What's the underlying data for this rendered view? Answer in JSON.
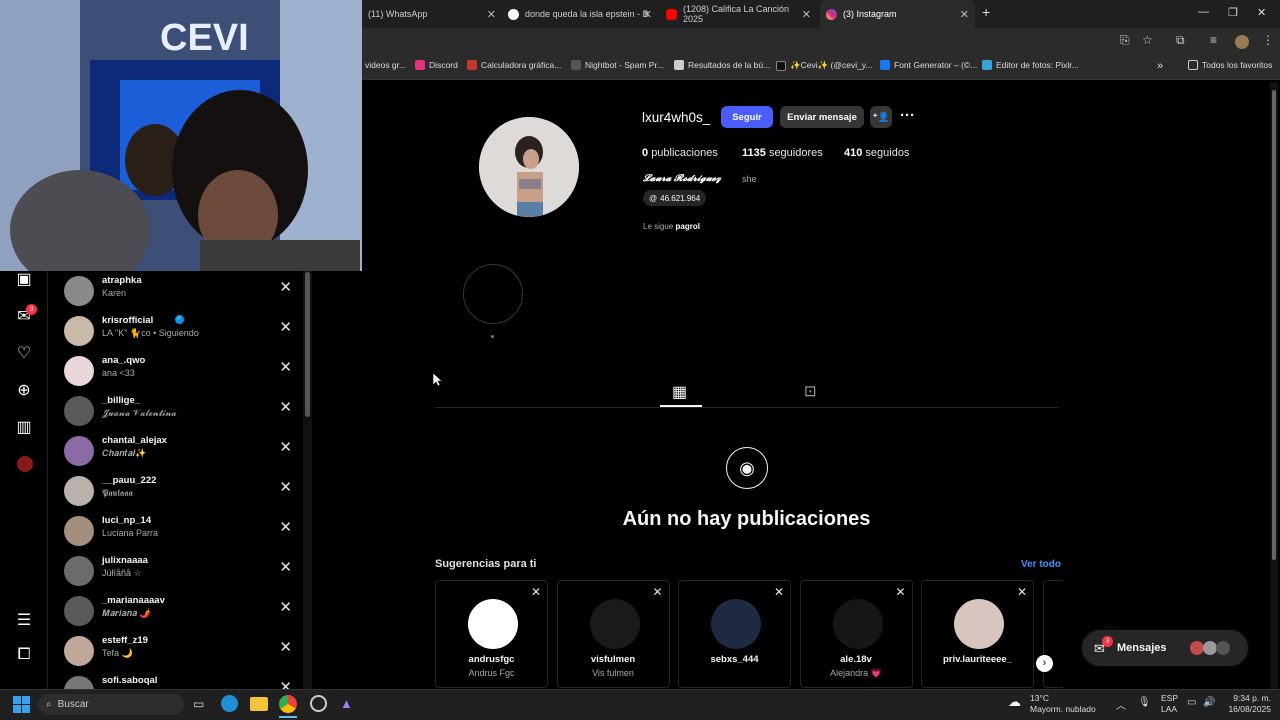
{
  "browser": {
    "tabs": [
      {
        "title": "(11) WhatsApp"
      },
      {
        "title": "donde queda la isla epstein - B"
      },
      {
        "title": "(1208) Califica La Canción 2025"
      },
      {
        "title": "(3) Instagram"
      }
    ],
    "bookmarks": [
      "videos gr...",
      "Discord",
      "Calculadora gráfica...",
      "Nightbot - Spam Pr...",
      "Resultados de la bú...",
      "✨Cevi✨ (@cevi_y...",
      "Font Generator – (©...",
      "Editor de fotos: Pixlr..."
    ],
    "all_favorites": "Todos los favoritos"
  },
  "sidebar": {
    "notification_badge": "3"
  },
  "suggest_list": [
    {
      "username": "atraphka",
      "sub": "Karen",
      "color": "#8a8a8a"
    },
    {
      "username": "krisrofficial",
      "sub": "LA \"K\" 🐈co • Siguiendo",
      "color": "#c9b9a9",
      "verified": true
    },
    {
      "username": "ana_.qwo",
      "sub": "ana <33",
      "color": "#e9d6d9"
    },
    {
      "username": "_billige_",
      "sub": "𝓙𝓾𝓪𝓷𝓪 𝓥𝓪𝓵𝓮𝓷𝓽𝓲𝓷𝓪",
      "color": "#5a5a5a"
    },
    {
      "username": "chantal_alejax",
      "sub": "𝑪𝒉𝒂𝒏𝒕𝒂𝒍✨",
      "color": "#8b6aa6"
    },
    {
      "username": "__pauu_222",
      "sub": "𝕻𝖆𝖚𝖑𝖆𝖆𝖆",
      "color": "#b9b1ac"
    },
    {
      "username": "luci_np_14",
      "sub": "Luciana Parra",
      "color": "#a48f7f"
    },
    {
      "username": "julixnaaaa",
      "sub": "Jüłîåñå ☆",
      "color": "#6b6b6b"
    },
    {
      "username": "_marianaaaav",
      "sub": "𝑴𝒂𝒓𝒊𝒂𝒏𝒂 🌶️",
      "color": "#5a5a5a"
    },
    {
      "username": "esteff_z19",
      "sub": "Tefa 🌙",
      "color": "#c0a89a"
    },
    {
      "username": "sofi.saboqal",
      "sub": "",
      "color": "#777"
    }
  ],
  "profile": {
    "username": "lxur4wh0s_",
    "follow_btn": "Seguir",
    "message_btn": "Enviar mensaje",
    "posts_count": "0",
    "posts_label": "publicaciones",
    "followers_count": "1135",
    "followers_label": "seguidores",
    "following_count": "410",
    "following_label": "seguidos",
    "full_name": "𝓛𝓪𝓾𝓻𝓪 𝓡𝓸𝓭𝓻𝓲𝓰𝓾𝓮𝔃",
    "pronoun": "she",
    "threads_badge": "46.621.964",
    "followed_by_prefix": "Le sigue",
    "followed_by_user": "pagrol",
    "no_posts": "Aún no hay publicaciones"
  },
  "suggestions": {
    "title": "Sugerencias para ti",
    "see_all": "Ver todo",
    "cards": [
      {
        "username": "andrusfgc",
        "name": "Andrus Fgc",
        "color": "#ffffff"
      },
      {
        "username": "visfulmen",
        "name": "Vis fulmen",
        "color": "#1a1a1a"
      },
      {
        "username": "sebxs_444",
        "name": "",
        "color": "#1e2a44"
      },
      {
        "username": "ale.18v",
        "name": "Alejandra 💗",
        "color": "#161616"
      },
      {
        "username": "priv.lauriteeee_",
        "name": "",
        "color": "#d8c5c0"
      }
    ]
  },
  "messages": {
    "label": "Mensajes",
    "badge": "3"
  },
  "taskbar": {
    "search": "Buscar",
    "weather_temp": "13°C",
    "weather_desc": "Mayorm. nublado",
    "lang1": "ESP",
    "lang2": "LAA",
    "time": "9:34 p. m.",
    "date": "16/08/2025"
  }
}
